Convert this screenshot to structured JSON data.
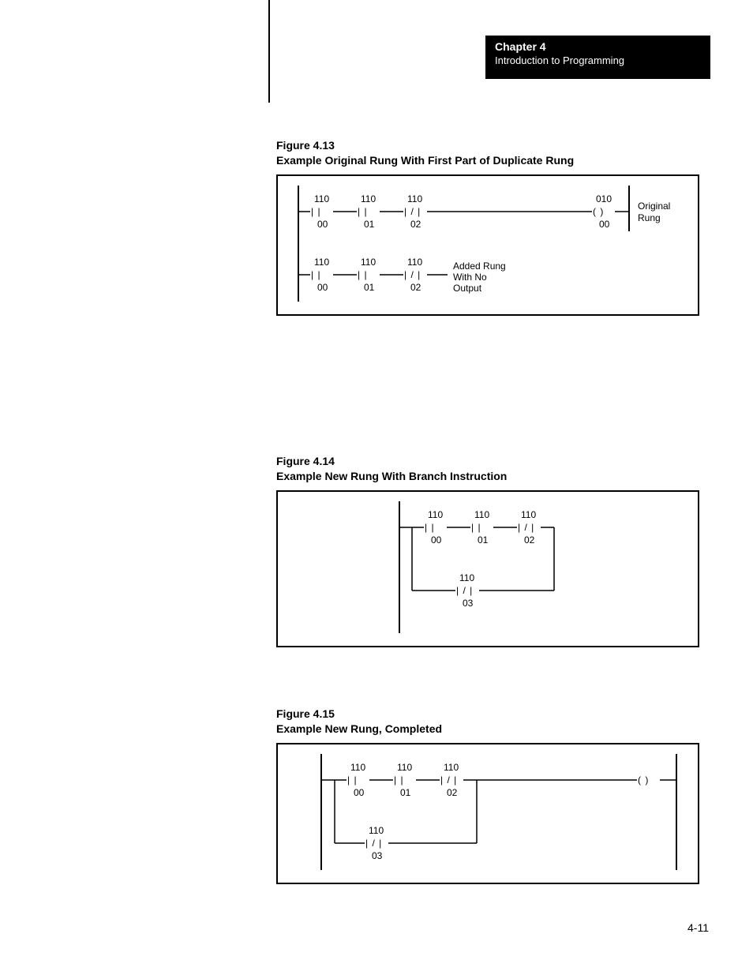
{
  "chapter": {
    "label": "Chapter 4",
    "title": "Introduction to Programming"
  },
  "page_number": "4-11",
  "figures": {
    "f413": {
      "number": "Figure 4.13",
      "caption": "Example Original Rung With First Part of Duplicate Rung",
      "rung1": {
        "c1_top": "110",
        "c1_sym": "|   |",
        "c1_bot": "00",
        "c2_top": "110",
        "c2_sym": "|   |",
        "c2_bot": "01",
        "c3_top": "110",
        "c3_sym": "| / |",
        "c3_bot": "02",
        "out_top": "010",
        "out_sym": "(   )",
        "out_bot": "00",
        "label1": "Original",
        "label2": "Rung"
      },
      "rung2": {
        "c1_top": "110",
        "c1_sym": "|   |",
        "c1_bot": "00",
        "c2_top": "110",
        "c2_sym": "|   |",
        "c2_bot": "01",
        "c3_top": "110",
        "c3_sym": "| / |",
        "c3_bot": "02",
        "label1": "Added Rung",
        "label2": "With No",
        "label3": "Output"
      }
    },
    "f414": {
      "number": "Figure 4.14",
      "caption": "Example New Rung With Branch Instruction",
      "top": {
        "c1_top": "110",
        "c1_sym": "|   |",
        "c1_bot": "00",
        "c2_top": "110",
        "c2_sym": "|   |",
        "c2_bot": "01",
        "c3_top": "110",
        "c3_sym": "| / |",
        "c3_bot": "02"
      },
      "branch": {
        "c_top": "110",
        "c_sym": "| / |",
        "c_bot": "03"
      }
    },
    "f415": {
      "number": "Figure 4.15",
      "caption": "Example New Rung, Completed",
      "top": {
        "c1_top": "110",
        "c1_sym": "|   |",
        "c1_bot": "00",
        "c2_top": "110",
        "c2_sym": "|   |",
        "c2_bot": "01",
        "c3_top": "110",
        "c3_sym": "| / |",
        "c3_bot": "02",
        "out_sym": "(   )"
      },
      "branch": {
        "c_top": "110",
        "c_sym": "| / |",
        "c_bot": "03"
      }
    }
  }
}
